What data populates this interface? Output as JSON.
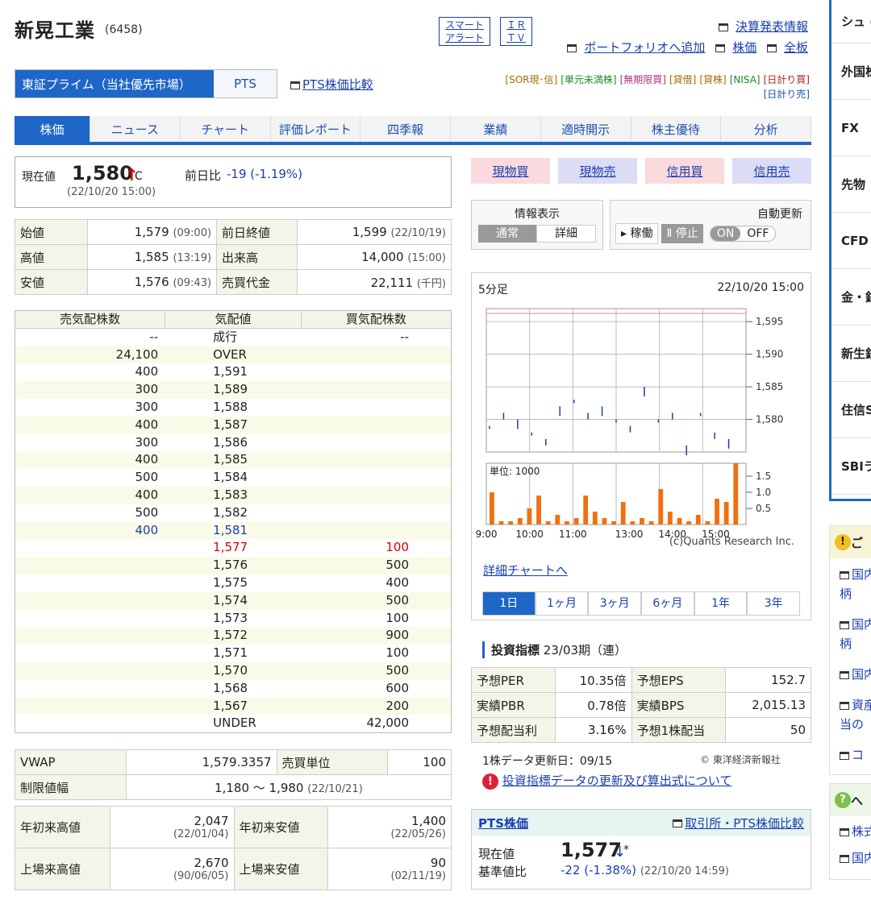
{
  "header": {
    "name": "新晃工業",
    "code": "(6458)",
    "smart_alert": [
      "スマート",
      "アラート"
    ],
    "irtv": [
      "ＩＲ",
      "ＴＶ"
    ],
    "kessan": "決算発表情報",
    "portfolio": "ポートフォリオへ追加",
    "kabuka": "株価",
    "zenban": "全板"
  },
  "market": {
    "active": "東証プライム（当社優先市場）",
    "pts": "PTS",
    "pts_compare": "PTS株価比較"
  },
  "badges": [
    "[SOR現･信]",
    "[単元未満株]",
    "[無期限買]",
    "[貸借]",
    "[貸株]",
    "[NISA]",
    "[日計り買]",
    "[日計り売]"
  ],
  "tabs": [
    "株価",
    "ニュース",
    "チャート",
    "評価レポート",
    "四季報",
    "業績",
    "適時開示",
    "株主優待",
    "分析"
  ],
  "current": {
    "label": "現在値",
    "price": "1,580",
    "arrow": "↑",
    "flag": "C",
    "change_label": "前日比",
    "change": "-19 (-1.19%)",
    "time": "(22/10/20 15:00)"
  },
  "ohlc": [
    {
      "l1": "始値",
      "v1": "1,579",
      "t1": "(09:00)",
      "l2": "前日終値",
      "v2": "1,599",
      "t2": "(22/10/19)"
    },
    {
      "l1": "高値",
      "v1": "1,585",
      "t1": "(13:19)",
      "l2": "出来高",
      "v2": "14,000",
      "t2": "(15:00)"
    },
    {
      "l1": "安値",
      "v1": "1,576",
      "t1": "(09:43)",
      "l2": "売買代金",
      "v2": "22,111",
      "t2": "(千円)"
    }
  ],
  "orderbook": {
    "headers": [
      "売気配株数",
      "気配値",
      "買気配株数"
    ],
    "rows": [
      [
        "--",
        "成行",
        "--"
      ],
      [
        "24,100",
        "OVER",
        ""
      ],
      [
        "400",
        "1,591",
        ""
      ],
      [
        "300",
        "1,589",
        ""
      ],
      [
        "300",
        "1,588",
        ""
      ],
      [
        "400",
        "1,587",
        ""
      ],
      [
        "300",
        "1,586",
        ""
      ],
      [
        "400",
        "1,585",
        ""
      ],
      [
        "500",
        "1,584",
        ""
      ],
      [
        "400",
        "1,583",
        ""
      ],
      [
        "500",
        "1,582",
        ""
      ],
      [
        "400",
        "1,581",
        ""
      ],
      [
        "",
        "1,577",
        "100"
      ],
      [
        "",
        "1,576",
        "500"
      ],
      [
        "",
        "1,575",
        "400"
      ],
      [
        "",
        "1,574",
        "500"
      ],
      [
        "",
        "1,573",
        "100"
      ],
      [
        "",
        "1,572",
        "900"
      ],
      [
        "",
        "1,571",
        "100"
      ],
      [
        "",
        "1,570",
        "500"
      ],
      [
        "",
        "1,568",
        "600"
      ],
      [
        "",
        "1,567",
        "200"
      ],
      [
        "",
        "UNDER",
        "42,000"
      ]
    ]
  },
  "vwap": {
    "label": "VWAP",
    "value": "1,579.3357",
    "unit_label": "売買単位",
    "unit": "100",
    "limit_label": "制限値幅",
    "limit": "1,180 ～ 1,980",
    "limit_date": "(22/10/21)"
  },
  "yearly": [
    {
      "l1": "年初来高値",
      "v1": "2,047",
      "d1": "(22/01/04)",
      "l2": "年初来安値",
      "v2": "1,400",
      "d2": "(22/05/26)"
    },
    {
      "l1": "上場来高値",
      "v1": "2,670",
      "d1": "(90/06/05)",
      "l2": "上場来安値",
      "v2": "90",
      "d2": "(02/11/19)"
    }
  ],
  "trade": [
    "現物買",
    "現物売",
    "信用買",
    "信用売"
  ],
  "info": {
    "label": "情報表示",
    "normal": "通常",
    "detail": "詳細",
    "auto_label": "自動更新",
    "run": "▸ 稼働",
    "stop": "Ⅱ 停止",
    "on": "ON",
    "off": "OFF"
  },
  "chart": {
    "interval": "5分足",
    "time": "22/10/20 15:00",
    "credit": "(c)Quants Research Inc.",
    "unit": "単位: 1000",
    "detail_link": "詳細チャートへ",
    "periods": [
      "1日",
      "1ヶ月",
      "3ヶ月",
      "6ヶ月",
      "1年",
      "3年"
    ]
  },
  "chart_data": {
    "type": "bar",
    "price_ticks": [
      "1,595",
      "1,590",
      "1,585",
      "1,580"
    ],
    "volume_ticks": [
      "1.5",
      "1.0",
      "0.5"
    ],
    "x_ticks": [
      "9:00",
      "10:00",
      "11:00",
      "13:00",
      "14:00",
      "15:00"
    ],
    "price_ylim": [
      1575,
      1597
    ],
    "vol_ylim": [
      0,
      1.9
    ],
    "price": [
      1579,
      1581,
      1580,
      1578,
      1577,
      1582,
      1583,
      1581,
      1582,
      1580,
      1579,
      1585,
      1580,
      1581,
      1576,
      1581,
      1578,
      1577
    ],
    "volume": [
      1.0,
      0.1,
      0.1,
      0.2,
      0.5,
      0.9,
      0.1,
      0.3,
      0.1,
      0.2,
      0.9,
      0.4,
      0.2,
      0.1,
      0.7,
      0.1,
      0.2,
      0.1,
      1.1,
      0.4,
      0.2,
      0.1,
      0.3,
      0.1,
      0.8,
      0.7,
      1.9
    ]
  },
  "indicators": {
    "title": "投資指標",
    "period": "23/03期（連）",
    "rows": [
      [
        "予想PER",
        "10.35倍",
        "予想EPS",
        "152.7"
      ],
      [
        "実績PBR",
        "0.78倍",
        "実績BPS",
        "2,015.13"
      ],
      [
        "予想配当利",
        "3.16%",
        "予想1株配当",
        "50"
      ]
    ],
    "updated": "1株データ更新日：09/15",
    "source": "© 東洋経済新報社",
    "note": "投資指標データの更新及び算出式について"
  },
  "pts": {
    "title": "PTS株価",
    "link": "取引所・PTS株価比較",
    "cur_label": "現在値",
    "price": "1,577",
    "arrow": "↓",
    "flag": "*",
    "base_label": "基準値比",
    "change": "-22 (-1.38%)",
    "time": "(22/10/20 14:59)"
  },
  "sidebar": [
    "シュ (未成",
    "外国株 信用の",
    "FX",
    "先物",
    "CFD (くり",
    "金・銀",
    "新生銀",
    "住信S",
    "SBIラ"
  ],
  "side2": {
    "head1": "ご",
    "items1": [
      "国内 柄",
      "国内 柄",
      "国内",
      "資産 当の",
      "コ"
    ],
    "head2": "へ",
    "items2": [
      "株式",
      "国内"
    ]
  }
}
